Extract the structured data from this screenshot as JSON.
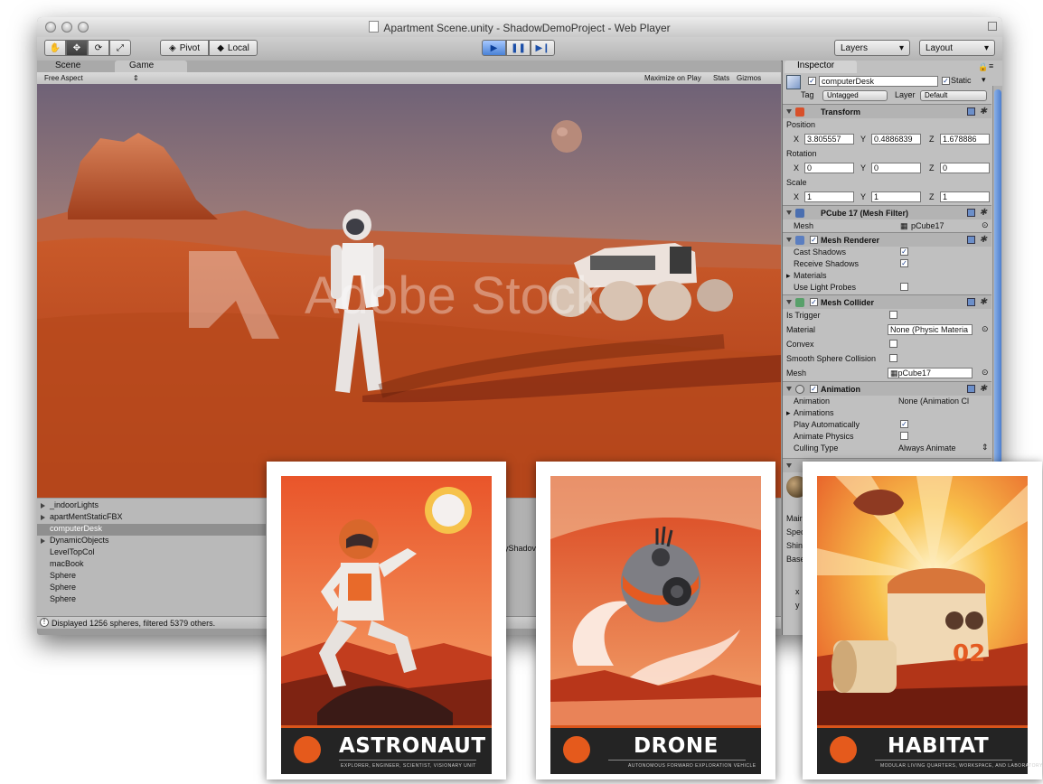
{
  "window": {
    "title": "Apartment Scene.unity - ShadowDemoProject - Web Player"
  },
  "toolbar": {
    "pivot_label": "Pivot",
    "local_label": "Local",
    "layers_label": "Layers",
    "layout_label": "Layout"
  },
  "tabs": {
    "scene": "Scene",
    "game": "Game"
  },
  "game_toolbar": {
    "aspect": "Free Aspect",
    "maximize": "Maximize on Play",
    "stats": "Stats",
    "gizmos": "Gizmos"
  },
  "viewport": {
    "watermark": "Adobe Stock"
  },
  "hierarchy": {
    "items": [
      {
        "label": "_indoorLights"
      },
      {
        "label": "apartMentStaticFBX"
      },
      {
        "label": "computerDesk"
      },
      {
        "label": "DynamicObjects"
      },
      {
        "label": "LevelTopCol"
      },
      {
        "label": "macBook"
      },
      {
        "label": "Sphere"
      },
      {
        "label": "Sphere"
      },
      {
        "label": "Sphere"
      }
    ],
    "middle_fragment": "yShadov"
  },
  "status": {
    "text": "Displayed 1256 spheres, filtered 5379 others."
  },
  "inspector": {
    "tab": "Inspector",
    "object_name": "computerDesk",
    "static_label": "Static",
    "tag_label": "Tag",
    "tag_value": "Untagged",
    "layer_label": "Layer",
    "layer_value": "Default",
    "transform": {
      "title": "Transform",
      "position_label": "Position",
      "position": {
        "x": "3.805557",
        "y": "0.4886839",
        "z": "1.678886"
      },
      "rotation_label": "Rotation",
      "rotation": {
        "x": "0",
        "y": "0",
        "z": "0"
      },
      "scale_label": "Scale",
      "scale": {
        "x": "1",
        "y": "1",
        "z": "1"
      },
      "x": "X",
      "y": "Y",
      "z": "Z"
    },
    "mesh_filter": {
      "title": "PCube 17 (Mesh Filter)",
      "mesh_label": "Mesh",
      "mesh_value": "pCube17"
    },
    "mesh_renderer": {
      "title": "Mesh Renderer",
      "cast_shadows": "Cast Shadows",
      "receive_shadows": "Receive Shadows",
      "materials": "Materials",
      "use_light_probes": "Use Light Probes",
      "cast_checked": true,
      "receive_checked": true,
      "probes_checked": false
    },
    "mesh_collider": {
      "title": "Mesh Collider",
      "is_trigger": "Is Trigger",
      "material_label": "Material",
      "material_value": "None (Physic Materia",
      "convex": "Convex",
      "smooth": "Smooth Sphere Collision",
      "mesh_label": "Mesh",
      "mesh_value": "pCube17"
    },
    "animation": {
      "title": "Animation",
      "animation_label": "Animation",
      "animation_value": "None (Animation Cl",
      "animations_label": "Animations",
      "play_auto": "Play Automatically",
      "animate_physics": "Animate Physics",
      "culling_label": "Culling Type",
      "culling_value": "Always Animate",
      "play_auto_checked": true,
      "animate_physics_checked": false
    },
    "material_fragments": [
      "Mair",
      "Spec",
      "Shin",
      "Base"
    ],
    "coord_fragments": [
      "x",
      "y"
    ]
  },
  "posters": [
    {
      "title": "ASTRONAUT",
      "subtitle": "EXPLORER, ENGINEER, SCIENTIST, VISIONARY UNIT"
    },
    {
      "title": "DRONE",
      "subtitle": "AUTONOMOUS FORWARD EXPLORATION VEHICLE"
    },
    {
      "title": "HABITAT",
      "subtitle": "MODULAR LIVING QUARTERS, WORKSPACE, AND LABORATORY",
      "module_number": "02"
    }
  ],
  "colors": {
    "accent_blue": "#4a82d6",
    "poster_orange": "#e55a1c",
    "banner_dark": "#242424",
    "mars_red": "#c4441e"
  }
}
